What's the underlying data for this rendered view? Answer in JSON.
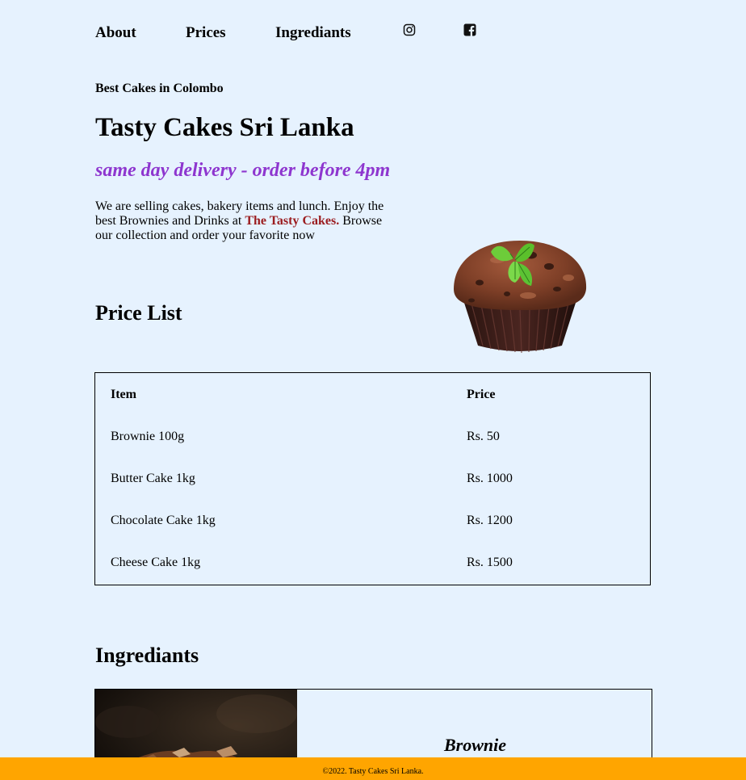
{
  "nav": {
    "items": [
      {
        "label": "About"
      },
      {
        "label": "Prices"
      },
      {
        "label": "Ingrediants"
      }
    ],
    "social": [
      {
        "icon": "instagram-icon"
      },
      {
        "icon": "facebook-icon"
      }
    ]
  },
  "hero": {
    "kicker": "Best Cakes in Colombo",
    "title": "Tasty Cakes Sri Lanka",
    "delivery": "same day delivery - order before 4pm",
    "intro_before": "We are selling cakes, bakery items and lunch. Enjoy the best Brownies and Drinks at",
    "intro_brand": "The Tasty Cakes.",
    "intro_after": "Browse our collection and order your favorite now",
    "image": "cupcake-image"
  },
  "prices": {
    "heading": "Price List",
    "columns": [
      "Item",
      "Price"
    ],
    "rows": [
      [
        "Brownie 100g",
        "Rs. 50"
      ],
      [
        "Butter Cake 1kg",
        "Rs. 1000"
      ],
      [
        "Chocolate Cake 1kg",
        "Rs. 1200"
      ],
      [
        "Cheese Cake 1kg",
        "Rs. 1500"
      ]
    ]
  },
  "ingredients": {
    "heading": "Ingrediants",
    "cards": [
      {
        "name": "Brownie",
        "image": "brownie-image"
      }
    ]
  },
  "footer": {
    "text": "©2022. Tasty Cakes Sri Lanka."
  },
  "colors": {
    "background": "#e6f2fe",
    "accent_purple": "#8e36cf",
    "brand_red": "#9b1d20",
    "footer": "#ffa500"
  }
}
